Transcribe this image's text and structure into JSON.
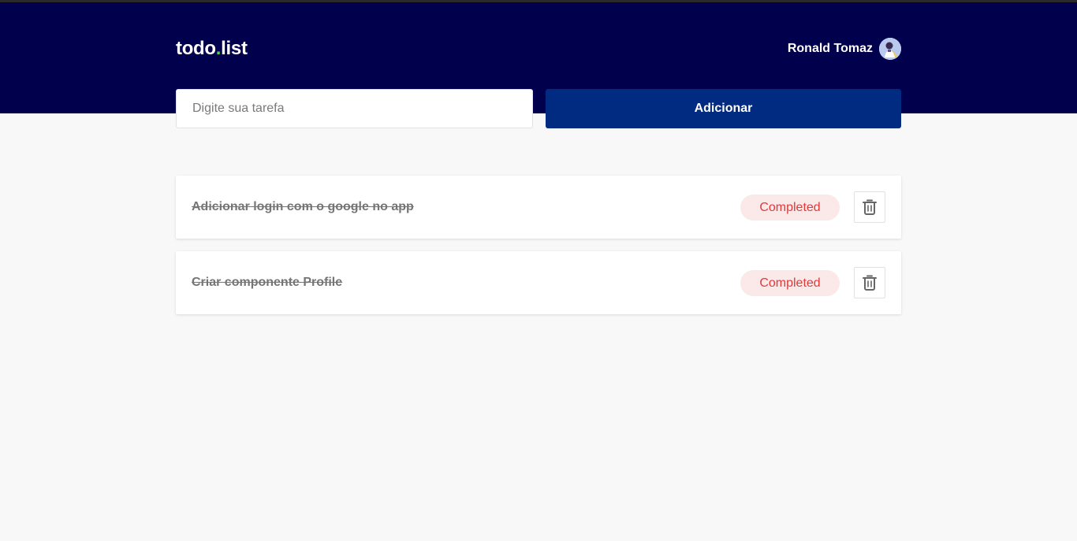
{
  "header": {
    "logo_part1": "todo",
    "logo_dot": ".",
    "logo_part2": "list",
    "user_name": "Ronald Tomaz"
  },
  "form": {
    "input_placeholder": "Digite sua tarefa",
    "input_value": "",
    "add_label": "Adicionar"
  },
  "tasks": [
    {
      "title": "Adicionar login com o google no app",
      "status": "Completed",
      "icon": "trash-icon"
    },
    {
      "title": "Criar componente Profile",
      "status": "Completed",
      "icon": "trash-icon"
    }
  ],
  "colors": {
    "header_bg": "#01004d",
    "button_bg": "#012b81",
    "logo_dot": "#4fd15a",
    "badge_bg": "#fbe8e8",
    "badge_text": "#e03a3a"
  }
}
